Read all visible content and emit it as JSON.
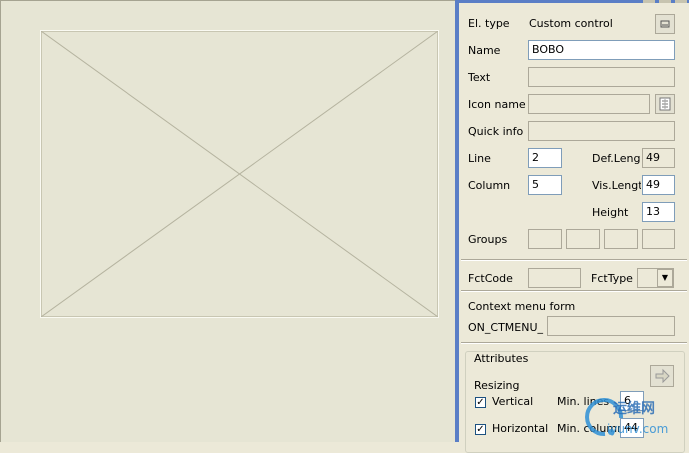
{
  "panel": {
    "el_type_label": "El. type",
    "el_type_value": "Custom control",
    "name_label": "Name",
    "name_value": "BOBO",
    "text_label": "Text",
    "icon_name_label": "Icon name",
    "quick_info_label": "Quick info",
    "line_label": "Line",
    "line_value": "2",
    "column_label": "Column",
    "column_value": "5",
    "def_length_label": "Def.Lengt",
    "def_length_value": "49",
    "vis_length_label": "Vis.Length",
    "vis_length_value": "49",
    "height_label": "Height",
    "height_value": "13",
    "groups_label": "Groups",
    "fctcode_label": "FctCode",
    "fcttype_label": "FctType",
    "context_menu_label": "Context menu form",
    "on_ctmenu_label": "ON_CTMENU_",
    "attributes_label": "Attributes",
    "resizing_label": "Resizing",
    "vertical_label": "Vertical",
    "vertical_checked": true,
    "min_lines_label": "Min. lines",
    "min_lines_value": "6",
    "horizontal_label": "Horizontal",
    "horizontal_checked": true,
    "min_columns_label": "Min. columns",
    "min_columns_value": "44"
  },
  "watermark": {
    "text_cn": "运维网",
    "text_url": "iyunv.com"
  },
  "colors": {
    "frame_blue": "#5a7ec6",
    "panel_bg": "#ece9d8",
    "canvas_bg": "#e6e5d4"
  }
}
